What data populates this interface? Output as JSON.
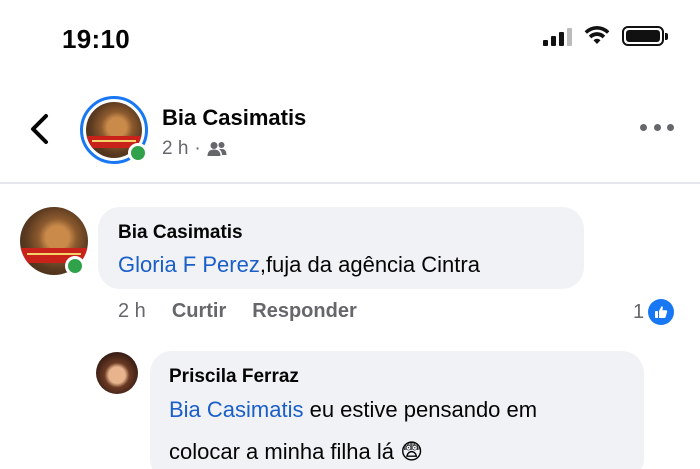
{
  "status_bar": {
    "time": "19:10"
  },
  "header": {
    "name": "Bia Casimatis",
    "time": "2 h",
    "separator": "·"
  },
  "comments": [
    {
      "author": "Bia Casimatis",
      "mention": "Gloria F Perez",
      "text": ",fuja da agência Cintra",
      "time": "2 h",
      "like_label": "Curtir",
      "reply_label": "Responder",
      "reaction_count": "1"
    },
    {
      "author": "Priscila Ferraz",
      "mention": "Bia Casimatis",
      "text_line1": " eu estive pensando em",
      "text_line2": "colocar a minha filha lá",
      "emoji": "😨"
    }
  ],
  "colors": {
    "accent": "#1877f2",
    "mention": "#1a5ec9",
    "online": "#31a24c"
  }
}
